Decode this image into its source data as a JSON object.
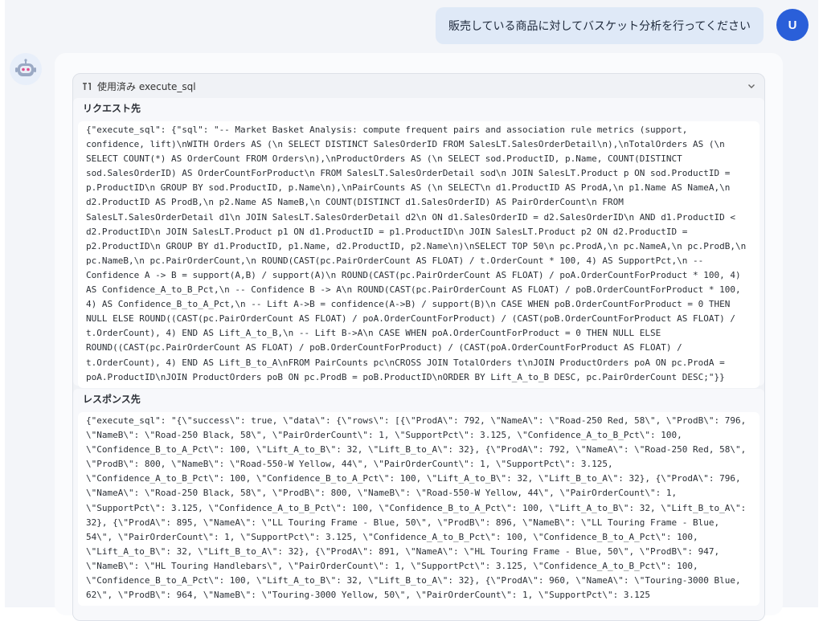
{
  "user": {
    "message": "販売している商品に対してバスケット分析を行ってください",
    "avatar_initial": "U"
  },
  "assistant": {
    "avatar_icon": "robot-icon",
    "tool_call": {
      "header_label": "使用済み execute_sql",
      "request_title": "リクエスト先",
      "request_lines": [
        "{\"execute_sql\": {\"sql\": \"-- Market Basket Analysis: compute frequent pairs and association rule metrics (support,",
        "confidence, lift)\\nWITH Orders AS (\\n SELECT DISTINCT SalesOrderID FROM SalesLT.SalesOrderDetail\\n),\\nTotalOrders AS (\\n",
        "SELECT COUNT(*) AS OrderCount FROM Orders\\n),\\nProductOrders AS (\\n SELECT sod.ProductID, p.Name, COUNT(DISTINCT",
        "sod.SalesOrderID) AS OrderCountForProduct\\n FROM SalesLT.SalesOrderDetail sod\\n JOIN SalesLT.Product p ON sod.ProductID =",
        "p.ProductID\\n GROUP BY sod.ProductID, p.Name\\n),\\nPairCounts AS (\\n SELECT\\n d1.ProductID AS ProdA,\\n p1.Name AS NameA,\\n",
        "d2.ProductID AS ProdB,\\n p2.Name AS NameB,\\n COUNT(DISTINCT d1.SalesOrderID) AS PairOrderCount\\n FROM",
        "SalesLT.SalesOrderDetail d1\\n JOIN SalesLT.SalesOrderDetail d2\\n ON d1.SalesOrderID = d2.SalesOrderID\\n AND d1.ProductID <",
        "d2.ProductID\\n JOIN SalesLT.Product p1 ON d1.ProductID = p1.ProductID\\n JOIN SalesLT.Product p2 ON d2.ProductID =",
        "p2.ProductID\\n GROUP BY d1.ProductID, p1.Name, d2.ProductID, p2.Name\\n)\\nSELECT TOP 50\\n pc.ProdA,\\n pc.NameA,\\n pc.ProdB,\\n",
        "pc.NameB,\\n pc.PairOrderCount,\\n ROUND(CAST(pc.PairOrderCount AS FLOAT) / t.OrderCount * 100, 4) AS SupportPct,\\n --",
        "Confidence A -> B = support(A,B) / support(A)\\n ROUND(CAST(pc.PairOrderCount AS FLOAT) / poA.OrderCountForProduct * 100, 4)",
        "AS Confidence_A_to_B_Pct,\\n -- Confidence B -> A\\n ROUND(CAST(pc.PairOrderCount AS FLOAT) / poB.OrderCountForProduct * 100,",
        "4) AS Confidence_B_to_A_Pct,\\n -- Lift A->B = confidence(A->B) / support(B)\\n CASE WHEN poB.OrderCountForProduct = 0 THEN",
        "NULL ELSE ROUND((CAST(pc.PairOrderCount AS FLOAT) / poA.OrderCountForProduct) / (CAST(poB.OrderCountForProduct AS FLOAT) /",
        "t.OrderCount), 4) END AS Lift_A_to_B,\\n -- Lift B->A\\n CASE WHEN poA.OrderCountForProduct = 0 THEN NULL ELSE",
        "ROUND((CAST(pc.PairOrderCount AS FLOAT) / poB.OrderCountForProduct) / (CAST(poA.OrderCountForProduct AS FLOAT) /",
        "t.OrderCount), 4) END AS Lift_B_to_A\\nFROM PairCounts pc\\nCROSS JOIN TotalOrders t\\nJOIN ProductOrders poA ON pc.ProdA =",
        "poA.ProductID\\nJOIN ProductOrders poB ON pc.ProdB = poB.ProductID\\nORDER BY Lift_A_to_B DESC, pc.PairOrderCount DESC;\"}}"
      ],
      "response_title": "レスポンス先",
      "response_lines": [
        "{\"execute_sql\": \"{\\\"success\\\": true, \\\"data\\\": {\\\"rows\\\": [{\\\"ProdA\\\": 792, \\\"NameA\\\": \\\"Road-250 Red, 58\\\", \\\"ProdB\\\": 796,",
        "\\\"NameB\\\": \\\"Road-250 Black, 58\\\", \\\"PairOrderCount\\\": 1, \\\"SupportPct\\\": 3.125, \\\"Confidence_A_to_B_Pct\\\": 100,",
        "\\\"Confidence_B_to_A_Pct\\\": 100, \\\"Lift_A_to_B\\\": 32, \\\"Lift_B_to_A\\\": 32}, {\\\"ProdA\\\": 792, \\\"NameA\\\": \\\"Road-250 Red, 58\\\",",
        "\\\"ProdB\\\": 800, \\\"NameB\\\": \\\"Road-550-W Yellow, 44\\\", \\\"PairOrderCount\\\": 1, \\\"SupportPct\\\": 3.125,",
        "\\\"Confidence_A_to_B_Pct\\\": 100, \\\"Confidence_B_to_A_Pct\\\": 100, \\\"Lift_A_to_B\\\": 32, \\\"Lift_B_to_A\\\": 32}, {\\\"ProdA\\\": 796,",
        "\\\"NameA\\\": \\\"Road-250 Black, 58\\\", \\\"ProdB\\\": 800, \\\"NameB\\\": \\\"Road-550-W Yellow, 44\\\", \\\"PairOrderCount\\\": 1,",
        "\\\"SupportPct\\\": 3.125, \\\"Confidence_A_to_B_Pct\\\": 100, \\\"Confidence_B_to_A_Pct\\\": 100, \\\"Lift_A_to_B\\\": 32, \\\"Lift_B_to_A\\\":",
        "32}, {\\\"ProdA\\\": 895, \\\"NameA\\\": \\\"LL Touring Frame - Blue, 50\\\", \\\"ProdB\\\": 896, \\\"NameB\\\": \\\"LL Touring Frame - Blue,",
        "54\\\", \\\"PairOrderCount\\\": 1, \\\"SupportPct\\\": 3.125, \\\"Confidence_A_to_B_Pct\\\": 100, \\\"Confidence_B_to_A_Pct\\\": 100,",
        "\\\"Lift_A_to_B\\\": 32, \\\"Lift_B_to_A\\\": 32}, {\\\"ProdA\\\": 891, \\\"NameA\\\": \\\"HL Touring Frame - Blue, 50\\\", \\\"ProdB\\\": 947,",
        "\\\"NameB\\\": \\\"HL Touring Handlebars\\\", \\\"PairOrderCount\\\": 1, \\\"SupportPct\\\": 3.125, \\\"Confidence_A_to_B_Pct\\\": 100,",
        "\\\"Confidence_B_to_A_Pct\\\": 100, \\\"Lift_A_to_B\\\": 32, \\\"Lift_B_to_A\\\": 32}, {\\\"ProdA\\\": 960, \\\"NameA\\\": \\\"Touring-3000 Blue,",
        "62\\\", \\\"ProdB\\\": 964, \\\"NameB\\\": \\\"Touring-3000 Yellow, 50\\\", \\\"PairOrderCount\\\": 1, \\\"SupportPct\\\": 3.125"
      ]
    }
  },
  "colors": {
    "user_avatar": "#2a5fd9",
    "user_bubble": "#dfe9f7",
    "app_background": "#f3f5f9"
  }
}
